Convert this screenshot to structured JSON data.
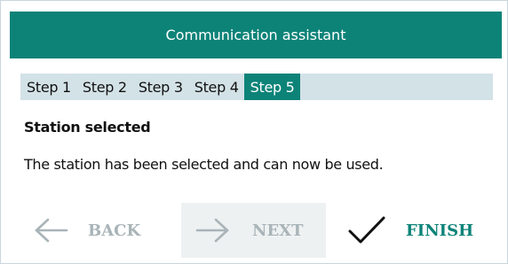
{
  "window": {
    "title": "Communication assistant"
  },
  "steps": [
    {
      "label": "Step 1",
      "active": false
    },
    {
      "label": "Step 2",
      "active": false
    },
    {
      "label": "Step 3",
      "active": false
    },
    {
      "label": "Step 4",
      "active": false
    },
    {
      "label": "Step 5",
      "active": true
    }
  ],
  "content": {
    "heading": "Station selected",
    "message": "The station has been selected and can now be used."
  },
  "buttons": {
    "back": {
      "label": "BACK",
      "icon": "arrow-left-icon",
      "enabled": false
    },
    "next": {
      "label": "NEXT",
      "icon": "arrow-right-icon",
      "enabled": false
    },
    "finish": {
      "label": "FINISH",
      "icon": "checkmark-icon",
      "enabled": true
    }
  },
  "colors": {
    "accent": "#0d8378",
    "step_bar_bg": "#d3e2e7",
    "disabled_text": "#a9b4b8"
  }
}
